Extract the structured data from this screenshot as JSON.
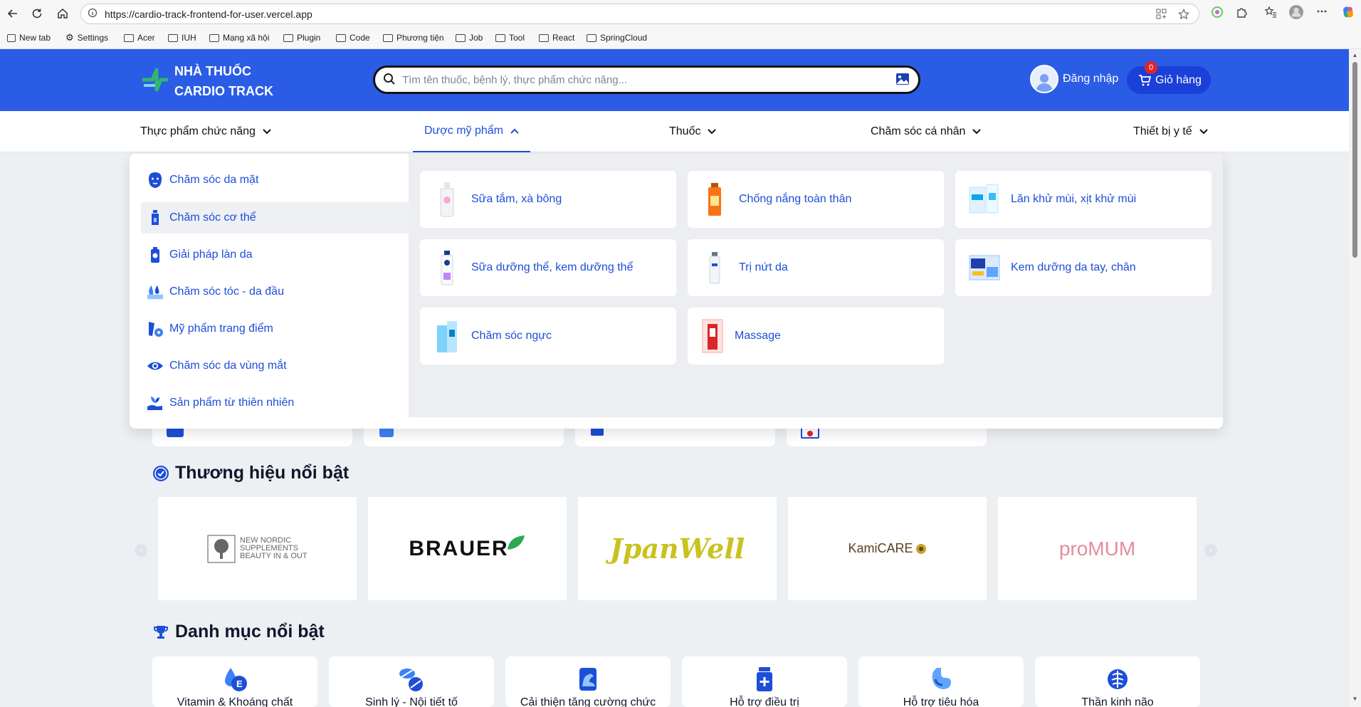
{
  "browser": {
    "url": "https://cardio-track-frontend-for-user.vercel.app",
    "bookmarks": [
      "New tab",
      "Settings",
      "Acer",
      "IUH",
      "Mạng xã hội",
      "Plugin",
      "Code",
      "Phương tiện",
      "Job",
      "Tool",
      "React",
      "SpringCloud"
    ]
  },
  "header": {
    "logo_line1": "NHÀ THUỐC",
    "logo_line2": "CARDIO TRACK",
    "search_placeholder": "Tìm tên thuốc, bệnh lý, thực phẩm chức năng...",
    "login_label": "Đăng nhập",
    "cart_label": "Giỏ hàng",
    "cart_count": "0"
  },
  "nav": {
    "items": [
      "Thực phẩm chức năng",
      "Dược mỹ phẩm",
      "Thuốc",
      "Chăm sóc cá nhân",
      "Thiết bị y tế"
    ],
    "active": "Dược mỹ phẩm"
  },
  "mega_menu": {
    "subcategories": [
      "Chăm sóc da mặt",
      "Chăm sóc cơ thể",
      "Giải pháp làn da",
      "Chăm sóc tóc - da đầu",
      "Mỹ phẩm trang điểm",
      "Chăm sóc da vùng mắt",
      "Sản phẩm từ thiên nhiên"
    ],
    "active_subcategory": "Chăm sóc cơ thể",
    "products": [
      "Sữa tắm, xà bông",
      "Chống nắng toàn thân",
      "Lăn khử mùi, xịt khử mùi",
      "Sữa dưỡng thể, kem dưỡng thể",
      "Trị nứt da",
      "Kem dưỡng da tay, chân",
      "Chăm sóc ngực",
      "Massage"
    ]
  },
  "brands": {
    "title": "Thương hiệu nổi bật",
    "items": [
      "NEW NORDIC SUPPLEMENTS BEAUTY IN & OUT",
      "BRAUER",
      "JpanWell",
      "KamiCARE",
      "proMUM"
    ]
  },
  "featured": {
    "title": "Danh mục nổi bật",
    "items": [
      "Vitamin & Khoáng chất",
      "Sinh lý - Nội tiết tố",
      "Cải thiện tăng cường chức",
      "Hỗ trợ điều trị",
      "Hỗ trợ tiêu hóa",
      "Thần kinh não"
    ]
  },
  "colors": {
    "brand_blue": "#2a5ce6",
    "link_blue": "#1d4ed8",
    "cart_blue": "#1b3fd9",
    "badge_red": "#e0252a"
  }
}
